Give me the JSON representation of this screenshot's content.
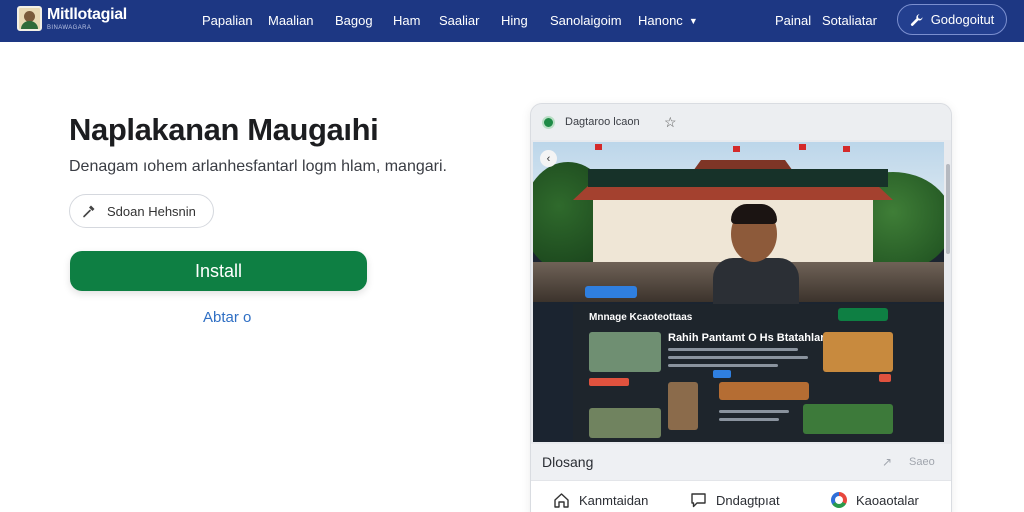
{
  "navbar": {
    "brand_name": "Mitllotagial",
    "brand_sub": "BINAWAGARA",
    "links": [
      "Papalian",
      "Maalian",
      "Bagog",
      "Ham",
      "Saaliar",
      "Hing",
      "Sanolaigoim",
      "Hanonc"
    ],
    "right_links": [
      "Painal",
      "Sotaliatar"
    ],
    "login_label": "Godogoitut"
  },
  "app": {
    "title": "Naplakanan Maugaıhi",
    "subtitle": "Denagam ıohem arlanhesfantarl logm hlam, mangari.",
    "secondary_button": "Sdoan Hehsnin",
    "install_button": "Install",
    "about_link": "Abtar o"
  },
  "preview": {
    "tab_label": "Dagtaroo lcaon",
    "screen": {
      "panel_title": "Mnnage Kcaoteottaas",
      "panel_heading": "Rahih Pantamt O Hs Btatahlar"
    },
    "footer_label": "Dlosang",
    "footer_note": "Saeo",
    "nav": [
      {
        "label": "Kanmtaidan",
        "icon": "home-icon"
      },
      {
        "label": "Dndagtpıat",
        "icon": "chat-icon"
      },
      {
        "label": "Kaoaotalar",
        "icon": "chrome-icon"
      }
    ]
  },
  "colors": {
    "navbar": "#1d3783",
    "install": "#0e7f43",
    "link": "#2f6fc4"
  }
}
